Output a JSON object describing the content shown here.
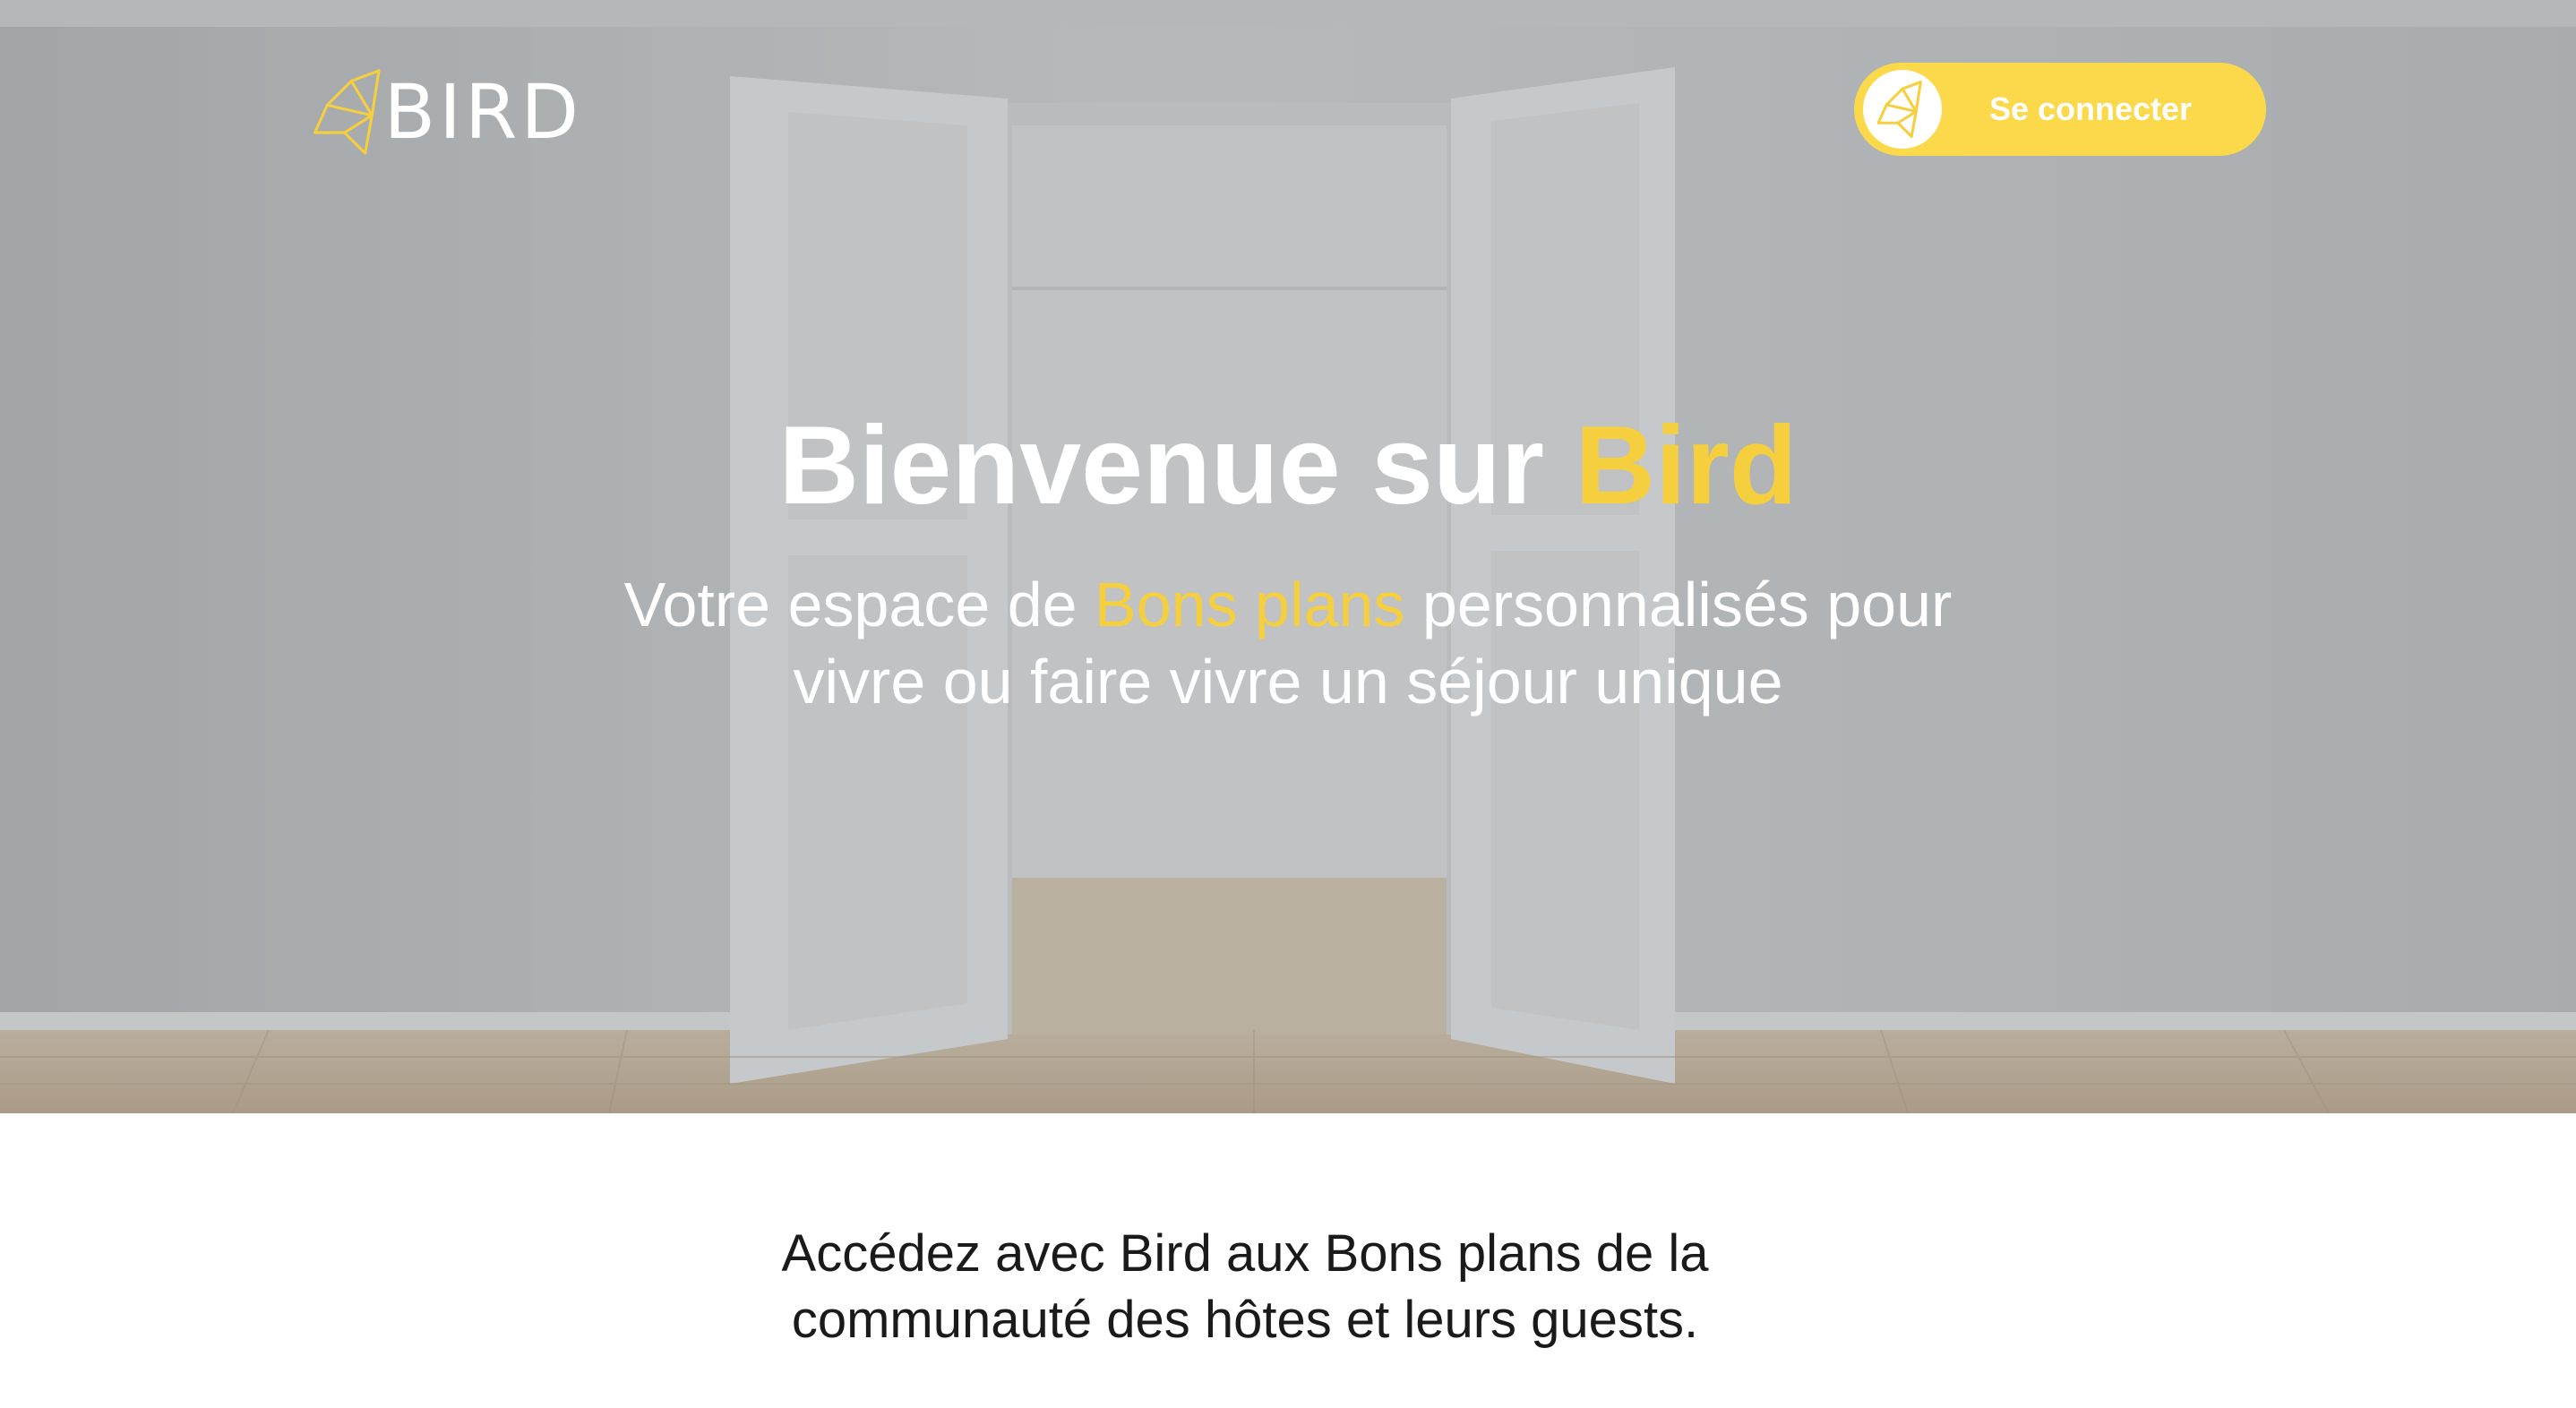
{
  "header": {
    "logo_text": "BIRD",
    "login_label": "Se connecter"
  },
  "hero": {
    "title_prefix": "Bienvenue sur ",
    "title_accent": "Bird",
    "subtitle_line1_prefix": "Votre espace de ",
    "subtitle_accent": "Bons plans",
    "subtitle_line1_suffix": " personnalisés pour",
    "subtitle_line2": "vivre ou faire vivre un séjour unique"
  },
  "intro": {
    "line1": "Accédez avec Bird aux Bons plans de la",
    "line2": "communauté des hôtes et leurs guests."
  },
  "colors": {
    "brand_yellow": "#fcd94a",
    "accent_text": "#f6cf3f",
    "hero_overlay": "#b8bcbf"
  },
  "icons": {
    "logo": "origami-bird-icon",
    "login": "origami-bird-icon"
  }
}
